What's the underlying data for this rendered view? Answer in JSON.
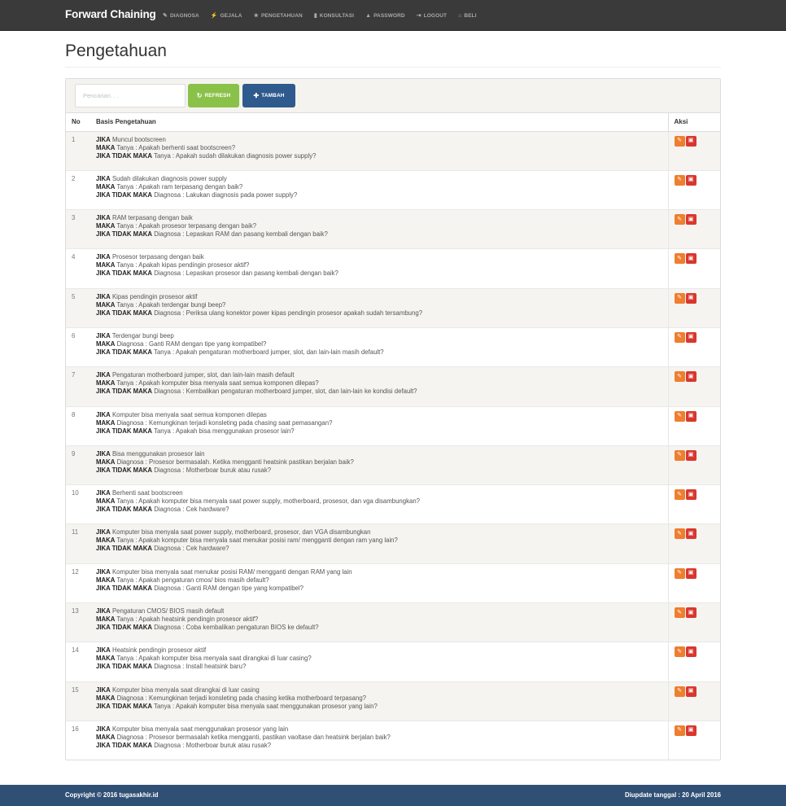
{
  "brand": "Forward Chaining",
  "nav": [
    {
      "icon": "wrench-icon",
      "glyph": "✎",
      "label": "DIAGNOSA"
    },
    {
      "icon": "flash-icon",
      "glyph": "⚡",
      "label": "GEJALA"
    },
    {
      "icon": "star-icon",
      "glyph": "★",
      "label": "PENGETAHUAN"
    },
    {
      "icon": "bar-chart-icon",
      "glyph": "▮",
      "label": "KONSULTASI"
    },
    {
      "icon": "lock-icon",
      "glyph": "▲",
      "label": "PASSWORD"
    },
    {
      "icon": "logout-icon",
      "glyph": "⇥",
      "label": "LOGOUT"
    },
    {
      "icon": "cart-icon",
      "glyph": "⌂",
      "label": "BELI"
    }
  ],
  "page": {
    "title": "Pengetahuan"
  },
  "toolbar": {
    "search_placeholder": "Pencarian. . .",
    "refresh_label": "REFRESH",
    "add_label": "TAMBAH"
  },
  "table": {
    "headers": {
      "no": "No",
      "basis": "Basis Pengetahuan",
      "aksi": "Aksi"
    },
    "keywords": {
      "if": "JIKA",
      "then": "MAKA",
      "else": "JIKA TIDAK MAKA"
    },
    "rows": [
      {
        "no": "1",
        "jika": "Muncul bootscreen",
        "maka": "Tanya : Apakah berhenti saat bootscreen?",
        "tidak": "Tanya : Apakah sudah dilakukan diagnosis power supply?"
      },
      {
        "no": "2",
        "jika": "Sudah dilakukan diagnosis power supply",
        "maka": "Tanya : Apakah ram terpasang dengan baik?",
        "tidak": "Diagnosa : Lakukan diagnosis pada power supply?"
      },
      {
        "no": "3",
        "jika": "RAM terpasang dengan baik",
        "maka": "Tanya : Apakah prosesor terpasang dengan baik?",
        "tidak": "Diagnosa : Lepaskan RAM dan pasang kembali dengan baik?"
      },
      {
        "no": "4",
        "jika": "Prosesor terpasang dengan baik",
        "maka": "Tanya : Apakah kipas pendingin prosesor aktif?",
        "tidak": "Diagnosa : Lepaskan prosesor dan pasang kembali dengan baik?"
      },
      {
        "no": "5",
        "jika": "Kipas pendingin prosesor aktif",
        "maka": "Tanya : Apakah terdengar bungi beep?",
        "tidak": "Diagnosa : Periksa ulang konektor power kipas pendingin prosesor apakah sudah tersambung?"
      },
      {
        "no": "6",
        "jika": "Terdengar bungi beep",
        "maka": "Diagnosa : Ganti RAM dengan tipe yang kompatibel?",
        "tidak": "Tanya : Apakah pengaturan motherboard jumper, slot, dan lain-lain masih default?"
      },
      {
        "no": "7",
        "jika": "Pengaturan motherboard jumper, slot, dan lain-lain masih default",
        "maka": "Tanya : Apakah komputer bisa menyala saat semua komponen dilepas?",
        "tidak": "Diagnosa : Kembalikan pengaturan motherboard jumper, slot, dan lain-lain ke kondisi default?"
      },
      {
        "no": "8",
        "jika": "Komputer bisa menyala saat semua komponen dilepas",
        "maka": "Diagnosa : Kemungkinan terjadi konsleting pada chasing saat pemasangan?",
        "tidak": "Tanya : Apakah bisa menggunakan prosesor lain?"
      },
      {
        "no": "9",
        "jika": "Bisa menggunakan prosesor lain",
        "maka": "Diagnosa : Prosesor bermasalah. Ketika mengganti heatsink pastikan berjalan baik?",
        "tidak": "Diagnosa : Motherboar buruk atau rusak?"
      },
      {
        "no": "10",
        "jika": "Berhenti saat bootscreen",
        "maka": "Tanya : Apakah komputer bisa menyala saat power supply, motherboard, prosesor, dan vga disambungkan?",
        "tidak": "Diagnosa : Cek hardware?"
      },
      {
        "no": "11",
        "jika": "Komputer bisa menyala saat power supply, motherboard, prosesor, dan VGA disambungkan",
        "maka": "Tanya : Apakah komputer bisa menyala saat menukar posisi ram/ mengganti dengan ram yang lain?",
        "tidak": "Diagnosa : Cek hardware?"
      },
      {
        "no": "12",
        "jika": "Komputer bisa menyala saat menukar posisi RAM/ mengganti dengan RAM yang lain",
        "maka": "Tanya : Apakah pengaturan cmos/ bios masih default?",
        "tidak": "Diagnosa : Ganti RAM dengan tipe yang kompatibel?"
      },
      {
        "no": "13",
        "jika": "Pengaturan CMOS/ BIOS masih default",
        "maka": "Tanya : Apakah heatsink pendingin prosesor aktif?",
        "tidak": "Diagnosa : Coba kembalikan pengaturan BIOS ke default?"
      },
      {
        "no": "14",
        "jika": "Heatsink pendingin prosesor aktif",
        "maka": "Tanya : Apakah komputer bisa menyala saat dirangkai di luar casing?",
        "tidak": "Diagnosa : Install heatsink baru?"
      },
      {
        "no": "15",
        "jika": "Komputer bisa menyala saat dirangkai di luar casing",
        "maka": "Diagnosa : Kemungkinan terjadi konsleting pada chasing ketika motherboard terpasang?",
        "tidak": "Tanya : Apakah komputer bisa menyala saat menggunakan prosesor yang lain?"
      },
      {
        "no": "16",
        "jika": "Komputer bisa menyala saat menggunakan prosesor yang lain",
        "maka": "Diagnosa : Prosesor bermasalah ketika mengganti, pastikan vaoltase dan heatsink berjalan baik?",
        "tidak": "Diagnosa : Motherboar buruk atau rusak?"
      }
    ]
  },
  "footer": {
    "copyright": "Copyright © 2016 tugasakhir.id",
    "updated": "Diupdate tanggal : 20 April 2016"
  }
}
